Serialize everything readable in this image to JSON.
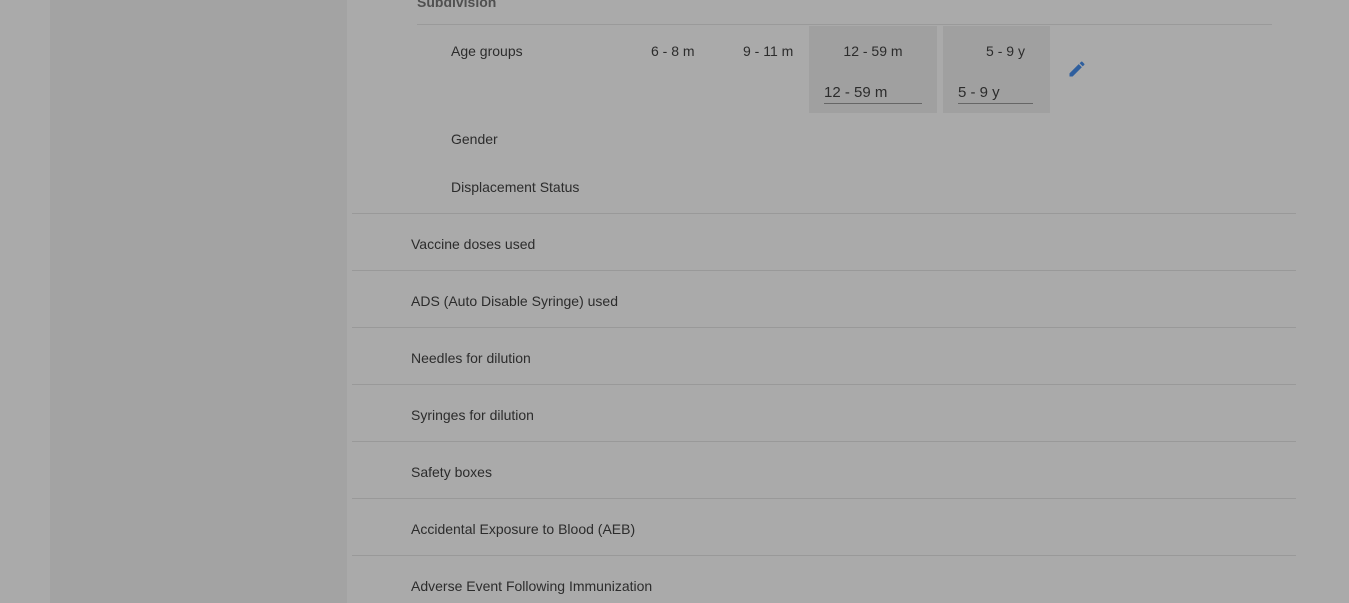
{
  "subdivision": {
    "header": "Subdivision",
    "age_groups_label": "Age groups",
    "age_columns": [
      "6 - 8 m",
      "9 - 11 m"
    ],
    "age_boxes": [
      {
        "header": "12 - 59 m",
        "value": "12 - 59 m"
      },
      {
        "header": "5 - 9 y",
        "value": "5 - 9 y"
      }
    ],
    "gender_label": "Gender",
    "displacement_label": "Displacement Status",
    "edit_icon": "pencil-icon"
  },
  "list": {
    "items": [
      {
        "label": "Vaccine doses used"
      },
      {
        "label": "ADS (Auto Disable Syringe) used"
      },
      {
        "label": "Needles for dilution"
      },
      {
        "label": "Syringes for dilution"
      },
      {
        "label": "Safety boxes"
      },
      {
        "label": "Accidental Exposure to Blood (AEB)"
      },
      {
        "label": "Adverse Event Following Immunization"
      }
    ]
  },
  "colors": {
    "icon_accent": "#2f5f9e"
  }
}
